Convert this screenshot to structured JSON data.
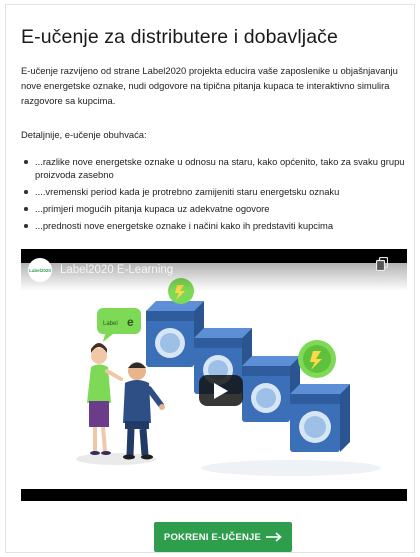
{
  "page": {
    "title": "E-učenje za distributere i dobavljače",
    "intro": "E-učenje razvijeno od strane Label2020 projekta educira vaše zaposlenike u objašnjavanju nove energetske oznake, nudi odgovore na tipična pitanja kupaca te interaktivno simulira razgovore sa kupcima.",
    "details_heading": "Detaljnije, e-učenje obuhvaća:",
    "bullets": [
      "...razlike nove energetske oznake u odnosu na staru, kako općenito, tako za svaku grupu proizvoda zasebno",
      "....vremenski period kada je protrebno zamijeniti staru energetsku oznaku",
      "...primjeri mogućih pitanja kupaca uz adekvatne ogovore",
      "...prednosti nove energetske oznake i načini kako ih predstaviti kupcima"
    ]
  },
  "video": {
    "title": "Label2020 E-Learning",
    "channel_logo_text": "Label2020",
    "copy_link_label": "Copy link",
    "play_icon": "play-icon",
    "scene_label_text": "Label"
  },
  "cta": {
    "label": "POKRENI E-UČENJE",
    "arrow_icon": "arrow-right-icon"
  },
  "colors": {
    "accent_green": "#2e9e4d",
    "machine_blue": "#3b6fb8",
    "light_green": "#7ed957"
  }
}
